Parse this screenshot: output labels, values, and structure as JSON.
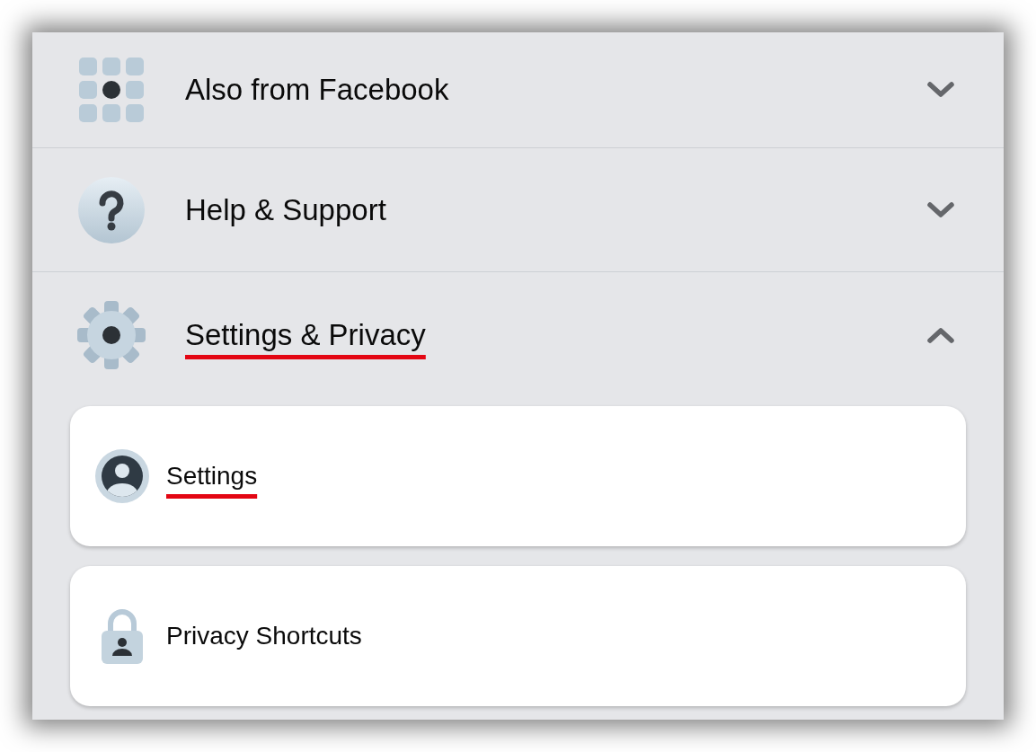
{
  "sections": [
    {
      "label": "Also from Facebook",
      "expanded": false,
      "marked": false
    },
    {
      "label": "Help & Support",
      "expanded": false,
      "marked": false
    },
    {
      "label": "Settings & Privacy",
      "expanded": true,
      "marked": true,
      "children": [
        {
          "label": "Settings",
          "marked": true
        },
        {
          "label": "Privacy Shortcuts",
          "marked": false
        }
      ]
    }
  ]
}
